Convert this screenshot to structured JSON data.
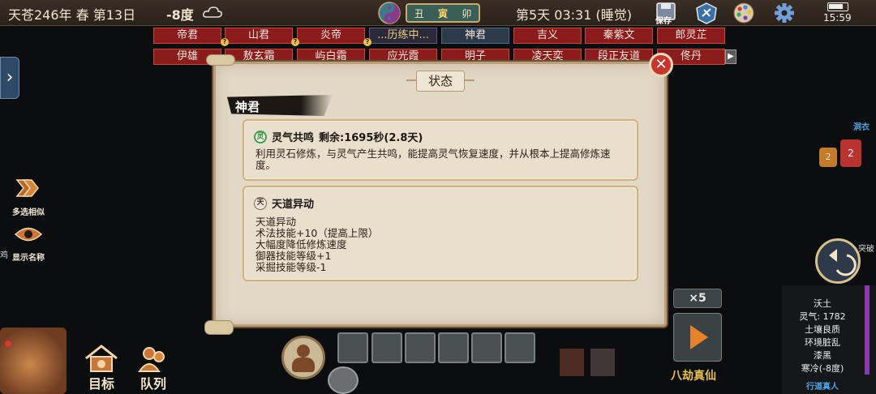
{
  "topbar": {
    "date": "天苍246年 春 第13日",
    "temperature": "-8度",
    "weather_icon": "cloud-icon",
    "branches": [
      "丑",
      "寅",
      "卯"
    ],
    "active_branch": "寅",
    "day_time": "第5天 03:31 (睡觉)",
    "save_label": "保存",
    "clock": "15:59"
  },
  "name_tabs": {
    "row1": [
      "帝君",
      "山君",
      "炎帝",
      "...历练中...",
      "神君",
      "吉义",
      "秦紫文",
      "郎灵芷"
    ],
    "row2": [
      "伊雄",
      "敖玄霜",
      "屿白霜",
      "应光霞",
      "明子",
      "凌天奕",
      "段正友道",
      "佟丹"
    ]
  },
  "side_buttons": {
    "multi_select": "多选相似",
    "show_names": "显示名称",
    "left_edge_char": "鸡"
  },
  "bottom_buttons": {
    "target": "目标",
    "team": "队列"
  },
  "dialog": {
    "title": "状态",
    "close_symbol": "✕",
    "character_name": "神君",
    "effects": [
      {
        "icon_char": "灵",
        "title": "灵气共鸣",
        "remaining": "剩余:1695秒(2.8天)",
        "description": "利用灵石修炼，与灵气产生共鸣，能提高灵气恢复速度，并从根本上提高修炼速度。"
      },
      {
        "icon_char": "天",
        "title": "天道异动",
        "lines": [
          "天道异动",
          "术法技能+10（提高上限）",
          "大幅度降低修炼速度",
          "御器技能等级+1",
          "采掘技能等级-1"
        ]
      }
    ]
  },
  "right_panel": {
    "blue_tag": "洞衣",
    "chat_count_1": "2",
    "chat_count_2": "2",
    "side_tag": "突破",
    "terrain_name": "沃土",
    "lingqi": "灵气: 1782",
    "soil": "土壤良质",
    "environment": "环境脏乱",
    "darkness": "漆黑",
    "cold": "寒冷(-8度)",
    "bottom_tag": "行道真人"
  },
  "speed": {
    "multiplier": "×5",
    "play_label": "八劫真仙"
  },
  "colors": {
    "accent_red": "#8b1c1c",
    "parchment": "#e2d8c6",
    "gold_border": "#cdb27c",
    "play_orange": "#e8822a"
  }
}
